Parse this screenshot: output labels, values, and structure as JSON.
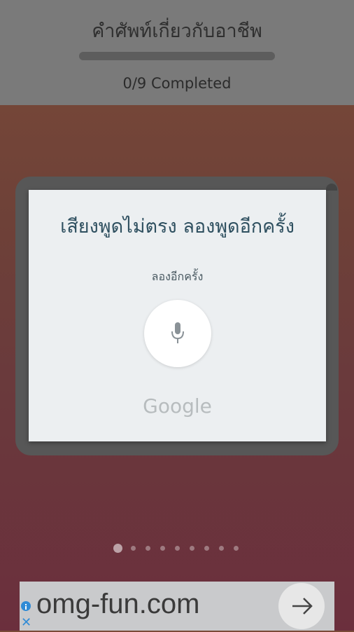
{
  "header": {
    "title": "คำศัพท์เกี่ยวกับอาชีพ",
    "progress": 0,
    "completed_text": "0/9 Completed"
  },
  "dialog": {
    "title": "เสียงพูดไม่ตรง ลองพูดอีกครั้ง",
    "subtitle": "ลองอีกครั้ง",
    "mic_icon": "mic-icon",
    "brand": "Google"
  },
  "pager": {
    "count": 9,
    "active_index": 0
  },
  "ad": {
    "text": "omg-fun.com",
    "arrow_icon": "arrow-right-icon",
    "info_icon": "info-icon",
    "close_icon": "close-icon"
  },
  "colors": {
    "header_bg": "#7a7a7a",
    "dialog_bg": "#eceff1",
    "title_text": "#2f5060",
    "ad_link": "#2f8bd6"
  }
}
